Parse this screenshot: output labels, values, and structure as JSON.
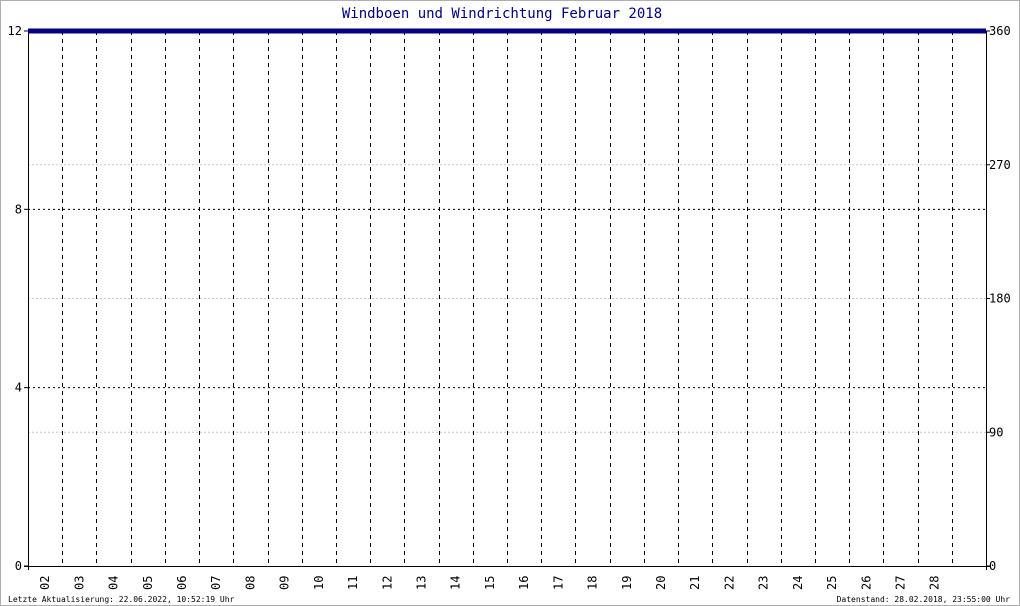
{
  "chart_data": {
    "type": "line",
    "title": "Windboen und Windrichtung Februar 2018",
    "xlabel": "",
    "ylabel": "",
    "x_ticks": [
      "02",
      "03",
      "04",
      "05",
      "06",
      "07",
      "08",
      "09",
      "10",
      "11",
      "12",
      "13",
      "14",
      "15",
      "16",
      "17",
      "18",
      "19",
      "20",
      "21",
      "22",
      "23",
      "24",
      "25",
      "26",
      "27",
      "28"
    ],
    "ylim_left": [
      0,
      12
    ],
    "y_ticks_left": [
      "0",
      "4",
      "8",
      "12"
    ],
    "ylim_right": [
      0,
      360
    ],
    "y_ticks_right": [
      "0",
      "90",
      "180",
      "270",
      "360"
    ],
    "grid": true,
    "series": [
      {
        "color": "#000080",
        "x_days": [
          1,
          29
        ],
        "values": [
          12,
          12
        ]
      }
    ],
    "footer_left": "Letzte Aktualisierung: 22.06.2022, 10:52:19 Uhr",
    "footer_right": "Datenstand: 28.02.2018, 23:55:00 Uhr"
  }
}
